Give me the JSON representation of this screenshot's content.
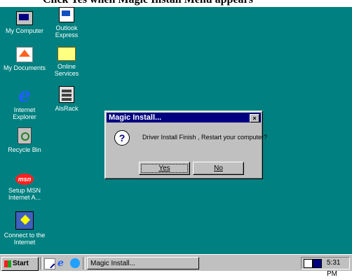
{
  "page_cutoff_text": "Click Yes when Magic Install Menu appears",
  "desktop": {
    "icons": [
      {
        "label": "My Computer",
        "icon": "my-computer-icon"
      },
      {
        "label": "Outlook Express",
        "icon": "outlook-express-icon"
      },
      {
        "label": "My Documents",
        "icon": "my-documents-icon"
      },
      {
        "label": "Online Services",
        "icon": "folder-icon"
      },
      {
        "label": "Internet Explorer",
        "icon": "internet-explorer-icon"
      },
      {
        "label": "AlsRack",
        "icon": "alsrack-icon"
      },
      {
        "label": "Recycle Bin",
        "icon": "recycle-bin-icon"
      },
      {
        "label": "Setup MSN Internet A...",
        "icon": "msn-icon"
      },
      {
        "label": "Connect to the Internet",
        "icon": "connect-internet-icon"
      }
    ],
    "background_color": "#008080"
  },
  "dialog": {
    "title": "Magic Install...",
    "close_label": "×",
    "message": "Driver Install Finish , Restart your computer?",
    "icon": "question-icon",
    "yes_label": "Yes",
    "no_label": "No"
  },
  "taskbar": {
    "start_label": "Start",
    "quick_launch": [
      "show-desktop-icon",
      "internet-explorer-icon",
      "outlook-express-icon"
    ],
    "task_label": "Magic Install...",
    "clock": "5:31 PM"
  }
}
